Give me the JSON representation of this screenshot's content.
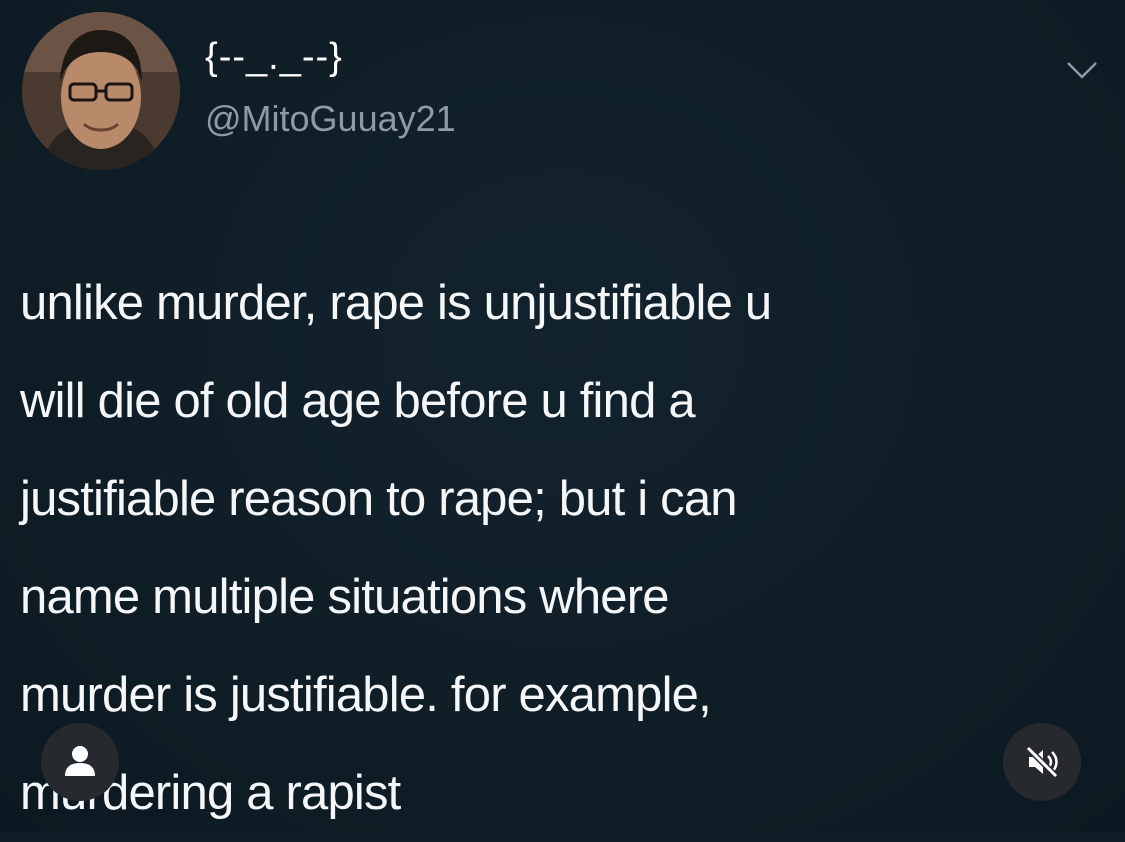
{
  "tweet": {
    "display_name": "{--_._--}",
    "handle": "@MitoGuuay21",
    "avatar_icon": "user-avatar-photo",
    "menu_icon": "chevron-down-icon",
    "text_lines": [
      "unlike murder, rape is unjustifiable u",
      "will die of old age before u find a",
      "justifiable reason to rape; but i can",
      "name multiple situations where",
      "murder is justifiable. for example,",
      "murdering a rapist"
    ]
  },
  "overlay": {
    "profile_icon": "person-icon",
    "mute_icon": "speaker-muted-icon"
  },
  "colors": {
    "background": "#0f1d26",
    "text": "#f4f6f8",
    "handle": "#8e9aa5",
    "button_bg": "#262a2f"
  }
}
